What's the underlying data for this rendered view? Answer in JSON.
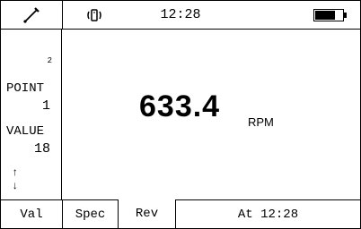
{
  "status_bar": {
    "probe_icon": "probe-icon",
    "vibration_icon": "vibration-icon",
    "time": "12:28",
    "battery_icon": "battery-icon",
    "battery_level": 0.75
  },
  "left_panel": {
    "index": "2",
    "point_label": "POINT",
    "point_value": "1",
    "value_label": "VALUE",
    "value_value": "18",
    "up_arrow": "↑",
    "down_arrow": "↓"
  },
  "main": {
    "reading": "633.4",
    "unit": "RPM"
  },
  "tabs": {
    "val": "Val",
    "spec": "Spec",
    "rev": "Rev",
    "at": "At 12:28",
    "active": "Rev"
  }
}
